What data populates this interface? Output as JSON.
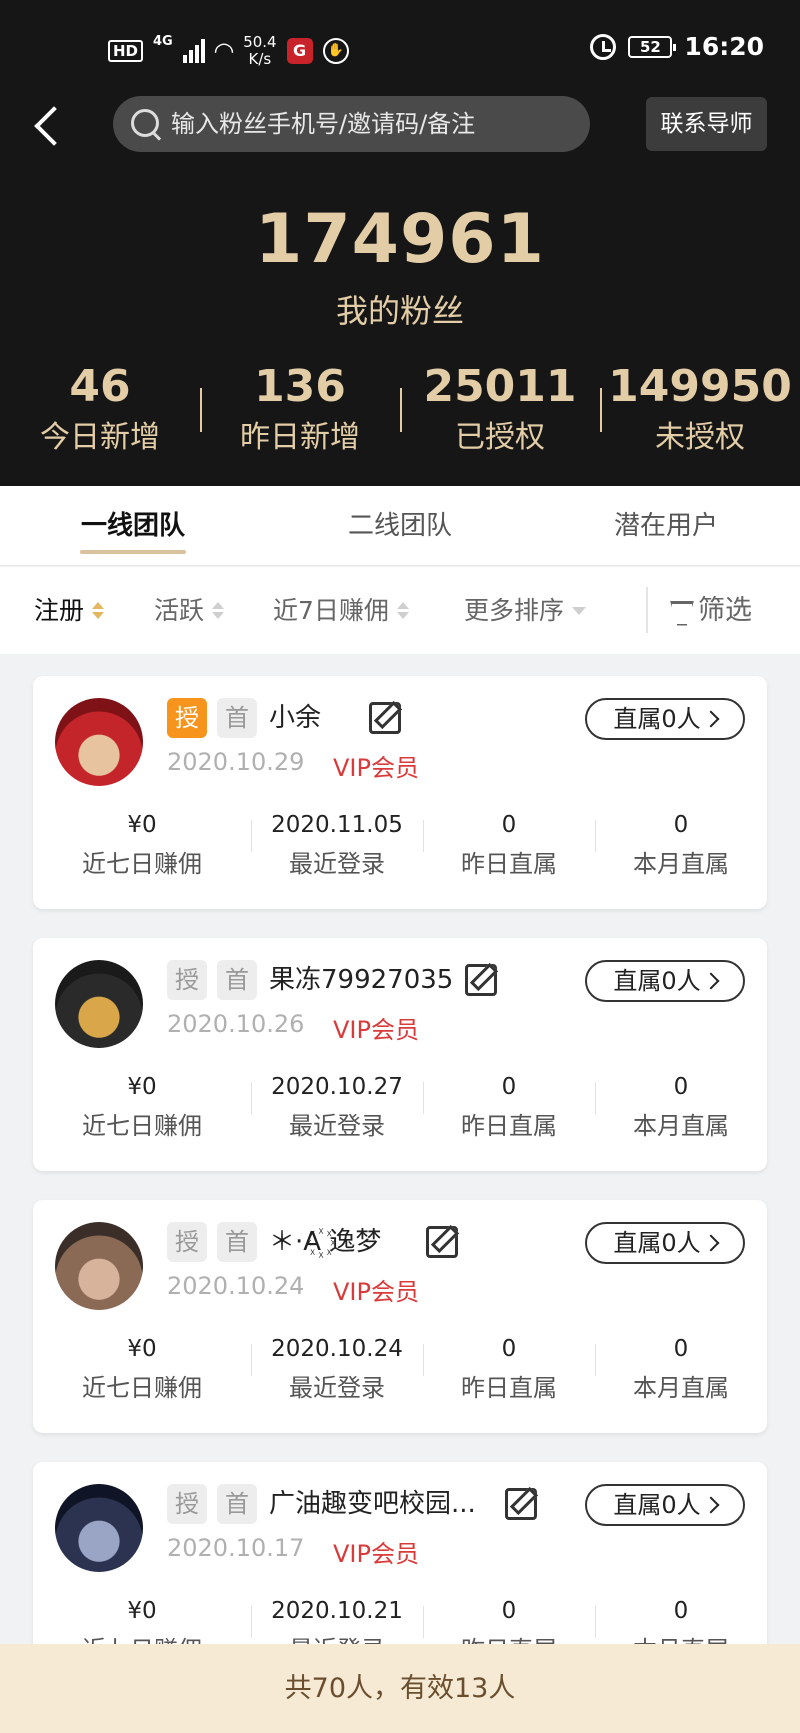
{
  "status_bar": {
    "hd": "HD",
    "network": "4G",
    "speed_value": "50.4",
    "speed_unit": "K/s",
    "app_icon_letter": "G",
    "battery": "52",
    "time": "16:20"
  },
  "header": {
    "search_placeholder": "输入粉丝手机号/邀请码/备注",
    "contact_button": "联系导师",
    "fans_count": "174961",
    "fans_label": "我的粉丝",
    "stats": [
      {
        "value": "46",
        "label": "今日新增"
      },
      {
        "value": "136",
        "label": "昨日新增"
      },
      {
        "value": "25011",
        "label": "已授权"
      },
      {
        "value": "149950",
        "label": "未授权"
      }
    ]
  },
  "tabs": [
    {
      "label": "一线团队",
      "active": true
    },
    {
      "label": "二线团队",
      "active": false
    },
    {
      "label": "潜在用户",
      "active": false
    }
  ],
  "sort": {
    "items": [
      "注册",
      "活跃",
      "近7日赚佣"
    ],
    "more": "更多排序",
    "filter": "筛选"
  },
  "members": [
    {
      "badge_auth": "授",
      "badge_first": "首",
      "auth_active": true,
      "nickname": "小余",
      "date": "2020.10.29",
      "vip": "VIP会员",
      "direct_label": "直属0人",
      "stats": [
        {
          "value": "¥0",
          "label": "近七日赚佣"
        },
        {
          "value": "2020.11.05",
          "label": "最近登录"
        },
        {
          "value": "0",
          "label": "昨日直属"
        },
        {
          "value": "0",
          "label": "本月直属"
        }
      ],
      "avatar_colors": [
        "#c4252a",
        "#7e1216",
        "#e7c49f"
      ]
    },
    {
      "badge_auth": "授",
      "badge_first": "首",
      "auth_active": false,
      "nickname": "果冻79927035",
      "date": "2020.10.26",
      "vip": "VIP会员",
      "direct_label": "直属0人",
      "stats": [
        {
          "value": "¥0",
          "label": "近七日赚佣"
        },
        {
          "value": "2020.10.27",
          "label": "最近登录"
        },
        {
          "value": "0",
          "label": "昨日直属"
        },
        {
          "value": "0",
          "label": "本月直属"
        }
      ],
      "avatar_colors": [
        "#2a2a2a",
        "#1a1a1a",
        "#d9a74a"
      ]
    },
    {
      "badge_auth": "授",
      "badge_first": "首",
      "auth_active": false,
      "nickname": "＊·A꙰ 逸梦",
      "date": "2020.10.24",
      "vip": "VIP会员",
      "direct_label": "直属0人",
      "stats": [
        {
          "value": "¥0",
          "label": "近七日赚佣"
        },
        {
          "value": "2020.10.24",
          "label": "最近登录"
        },
        {
          "value": "0",
          "label": "昨日直属"
        },
        {
          "value": "0",
          "label": "本月直属"
        }
      ],
      "avatar_colors": [
        "#8a6a55",
        "#3b2e28",
        "#d6b39a"
      ]
    },
    {
      "badge_auth": "授",
      "badge_first": "首",
      "auth_active": false,
      "nickname": "广油趣变吧校园...",
      "date": "2020.10.17",
      "vip": "VIP会员",
      "direct_label": "直属0人",
      "stats": [
        {
          "value": "¥0",
          "label": "近七日赚佣"
        },
        {
          "value": "2020.10.21",
          "label": "最近登录"
        },
        {
          "value": "0",
          "label": "昨日直属"
        },
        {
          "value": "0",
          "label": "本月直属"
        }
      ],
      "avatar_colors": [
        "#2b3350",
        "#0f1426",
        "#9aa4c4"
      ]
    }
  ],
  "footer": {
    "text": "共70人，有效13人"
  }
}
